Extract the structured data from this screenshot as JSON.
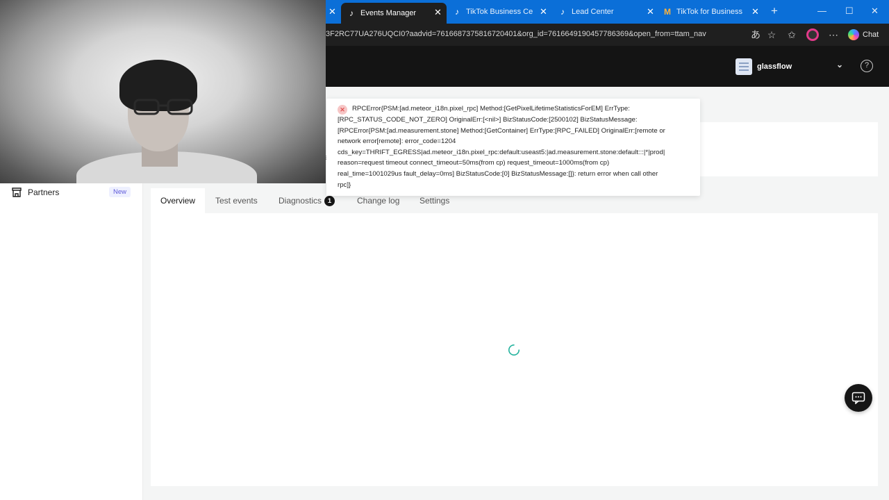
{
  "browser": {
    "tabs": [
      {
        "title": "Events Manager",
        "active": true
      },
      {
        "title": "TikTok Business Center",
        "active": false
      },
      {
        "title": "Lead Center",
        "active": false
      },
      {
        "title": "TikTok for Business Veri",
        "active": false
      }
    ],
    "url": "3F2RC77UA276UQCI0?aadvid=7616687375816720401&org_id=7616649190457786369&open_from=ttam_nav",
    "chat_label": "Chat"
  },
  "topnav": {
    "account_name": "glassflow"
  },
  "sidebar": {
    "items": [
      {
        "label": "Partners",
        "badge": "New",
        "icon": "store-icon"
      }
    ]
  },
  "page_tabs": [
    {
      "label": "Overview",
      "active": true
    },
    {
      "label": "Test events",
      "active": false
    },
    {
      "label": "Diagnostics",
      "badge": "1",
      "active": false
    },
    {
      "label": "Change log",
      "active": false
    },
    {
      "label": "Settings",
      "active": false
    }
  ],
  "error_toast": {
    "lines": [
      "RPCError{PSM:[ad.meteor_i18n.pixel_rpc] Method:[GetPixelLifetimeStatisticsForEM] ErrType:",
      "[RPC_STATUS_CODE_NOT_ZERO] OriginalErr:[<nil>] BizStatusCode:[2500102] BizStatusMessage:",
      "[RPCError{PSM:[ad.measurement.stone] Method:[GetContainer] ErrType:[RPC_FAILED] OriginalErr:[remote or",
      "network error[remote]: error_code=1204",
      "cds_key=THRIFT_EGRESS|ad.meteor_i18n.pixel_rpc:default:useast5:|ad.measurement.stone:default:::|*|prod|",
      "reason=request timeout connect_timeout=50ms(from cp) request_timeout=1000ms(from cp)",
      "real_time=1001029us fault_delay=0ms] BizStatusCode:[0] BizStatusMessage:[]}: return error when call other",
      "rpc]}"
    ]
  },
  "colors": {
    "tabbar": "#0b6fd8",
    "chrome_dark": "#1f1f1f",
    "topnav": "#141414",
    "page_bg": "#f4f5f5",
    "spinner": "#25b39e",
    "error": "#e05656"
  }
}
